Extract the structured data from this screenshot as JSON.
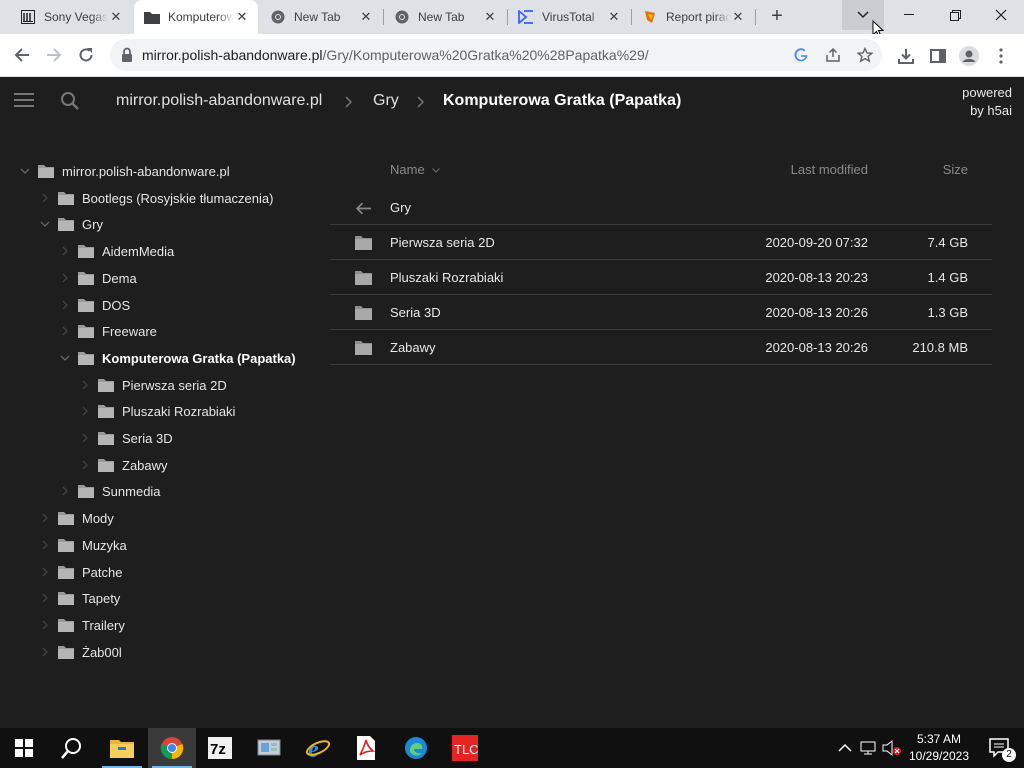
{
  "browser": {
    "tabs": [
      {
        "title": "Sony Vegas",
        "icon": "library-icon",
        "active": false
      },
      {
        "title": "Komputerowa Gratka",
        "icon": "folder-icon",
        "active": true
      },
      {
        "title": "New Tab",
        "icon": "chrome-icon",
        "active": false
      },
      {
        "title": "New Tab",
        "icon": "chrome-icon",
        "active": false
      },
      {
        "title": "VirusTotal",
        "icon": "virustotal-icon",
        "active": false
      },
      {
        "title": "Report piracy",
        "icon": "report-icon",
        "active": false
      }
    ],
    "url_host": "mirror.polish-abandonware.pl",
    "url_path": "/Gry/Komputerowa%20Gratka%20%28Papatka%29/"
  },
  "h5ai": {
    "breadcrumbs": [
      "mirror.polish-abandonware.pl",
      "Gry",
      "Komputerowa Gratka (Papatka)"
    ],
    "powered_line1": "powered",
    "powered_line2": "by h5ai",
    "tree": [
      {
        "label": "mirror.polish-abandonware.pl",
        "level": 0,
        "expanded": true,
        "current": false
      },
      {
        "label": "Bootlegs (Rosyjskie tłumaczenia)",
        "level": 1,
        "expanded": false,
        "current": false
      },
      {
        "label": "Gry",
        "level": 1,
        "expanded": true,
        "current": false
      },
      {
        "label": "AidemMedia",
        "level": 2,
        "expanded": false,
        "current": false
      },
      {
        "label": "Dema",
        "level": 2,
        "expanded": false,
        "current": false
      },
      {
        "label": "DOS",
        "level": 2,
        "expanded": false,
        "current": false
      },
      {
        "label": "Freeware",
        "level": 2,
        "expanded": false,
        "current": false
      },
      {
        "label": "Komputerowa Gratka (Papatka)",
        "level": 2,
        "expanded": true,
        "current": true
      },
      {
        "label": "Pierwsza seria 2D",
        "level": 3,
        "expanded": false,
        "current": false
      },
      {
        "label": "Pluszaki Rozrabiaki",
        "level": 3,
        "expanded": false,
        "current": false
      },
      {
        "label": "Seria 3D",
        "level": 3,
        "expanded": false,
        "current": false
      },
      {
        "label": "Zabawy",
        "level": 3,
        "expanded": false,
        "current": false
      },
      {
        "label": "Sunmedia",
        "level": 2,
        "expanded": false,
        "current": false
      },
      {
        "label": "Mody",
        "level": 1,
        "expanded": false,
        "current": false
      },
      {
        "label": "Muzyka",
        "level": 1,
        "expanded": false,
        "current": false
      },
      {
        "label": "Patche",
        "level": 1,
        "expanded": false,
        "current": false
      },
      {
        "label": "Tapety",
        "level": 1,
        "expanded": false,
        "current": false
      },
      {
        "label": "Trailery",
        "level": 1,
        "expanded": false,
        "current": false
      },
      {
        "label": "Żab00l",
        "level": 1,
        "expanded": false,
        "current": false
      }
    ],
    "columns": {
      "name": "Name",
      "modified": "Last modified",
      "size": "Size"
    },
    "parent_label": "Gry",
    "rows": [
      {
        "name": "Pierwsza seria 2D",
        "modified": "2020-09-20 07:32",
        "size": "7.4 GB"
      },
      {
        "name": "Pluszaki Rozrabiaki",
        "modified": "2020-08-13 20:23",
        "size": "1.4 GB"
      },
      {
        "name": "Seria 3D",
        "modified": "2020-08-13 20:26",
        "size": "1.3 GB"
      },
      {
        "name": "Zabawy",
        "modified": "2020-08-13 20:26",
        "size": "210.8 MB"
      }
    ]
  },
  "taskbar": {
    "time": "5:37 AM",
    "date": "10/29/2023",
    "notification_count": "2"
  }
}
